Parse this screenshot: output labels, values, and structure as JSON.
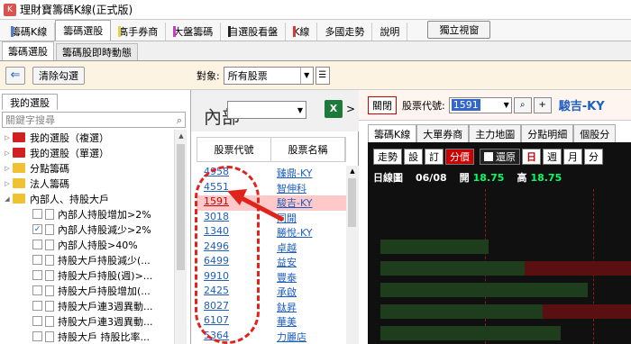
{
  "window": {
    "icon": "app-logo-icon",
    "title": "理財寶籌碼K線(正式版)"
  },
  "main_tabs": [
    {
      "label": "籌碼K線",
      "color": "#4a7fd4"
    },
    {
      "label": "籌碼選股",
      "color": "",
      "active": true
    },
    {
      "label": "高手券商",
      "color": "#e8d24a"
    },
    {
      "label": "大盤籌碼",
      "color": "#c83cc8"
    },
    {
      "label": "自選股看盤",
      "color": "#222222"
    },
    {
      "label": "K線",
      "color": "#d43c3c"
    },
    {
      "label": "多國走勢",
      "color": ""
    },
    {
      "label": "說明",
      "color": ""
    }
  ],
  "standalone_btn": "獨立視窗",
  "sub_tabs": [
    {
      "label": "籌碼選股",
      "active": true
    },
    {
      "label": "籌碼股即時動態",
      "active": false
    }
  ],
  "toolbar": {
    "clear_label": "清除勾選",
    "target_label": "對象:",
    "target_value": "所有股票"
  },
  "left": {
    "tab": "我的選股",
    "search_placeholder": "關鍵字搜尋",
    "items": [
      {
        "label": "我的選股（複選）",
        "folder": "#d21f1f",
        "type": "folder"
      },
      {
        "label": "我的選股（單選）",
        "folder": "#d21f1f",
        "type": "folder"
      },
      {
        "label": "分點籌碼",
        "folder": "#f0c232",
        "type": "folder"
      },
      {
        "label": "法人籌碼",
        "folder": "#f0c232",
        "type": "folder"
      },
      {
        "label": "內部人、持股大戶",
        "folder": "#f0c232",
        "type": "open"
      },
      {
        "label": "內部人持股增加>2%",
        "checked": false,
        "type": "leaf"
      },
      {
        "label": "內部人持股減少>2%",
        "checked": true,
        "type": "leaf"
      },
      {
        "label": "內部人持股>40%",
        "checked": false,
        "type": "leaf"
      },
      {
        "label": "持股大戶持股減少(...",
        "checked": false,
        "type": "leaf"
      },
      {
        "label": "持股大戶持股(週)>...",
        "checked": false,
        "type": "leaf"
      },
      {
        "label": "持股大戶持股增加(...",
        "checked": false,
        "type": "leaf"
      },
      {
        "label": "持股大戶連3週異動...",
        "checked": false,
        "type": "leaf"
      },
      {
        "label": "持股大戶連3週異動...",
        "checked": false,
        "type": "leaf"
      },
      {
        "label": "持股大戶 持股比率...",
        "checked": false,
        "type": "leaf"
      }
    ]
  },
  "mid": {
    "inner_label": "內部",
    "select_value": "",
    "excel_icon": "excel-icon",
    "col_code": "股票代號",
    "col_name": "股票名稱",
    "rows": [
      {
        "code": "4958",
        "name": "臻鼎-KY",
        "selected": false
      },
      {
        "code": "4551",
        "name": "智伸科",
        "selected": false
      },
      {
        "code": "1591",
        "name": "駿吉-KY",
        "selected": true
      },
      {
        "code": "3018",
        "name": "同開",
        "selected": false
      },
      {
        "code": "1340",
        "name": "勝悅-KY",
        "selected": false
      },
      {
        "code": "2496",
        "name": "卓越",
        "selected": false
      },
      {
        "code": "6499",
        "name": "益安",
        "selected": false
      },
      {
        "code": "9910",
        "name": "豐泰",
        "selected": false
      },
      {
        "code": "2425",
        "name": "承啟",
        "selected": false
      },
      {
        "code": "8027",
        "name": "鈦昇",
        "selected": false
      },
      {
        "code": "6107",
        "name": "華美",
        "selected": false
      },
      {
        "code": "5364",
        "name": "力麗店",
        "selected": false
      }
    ]
  },
  "right": {
    "close_btn": "關閉",
    "code_label": "股票代號:",
    "code_value": "1591",
    "stock_name": "駿吉-KY",
    "tabs": [
      {
        "label": "籌碼K線",
        "active": true
      },
      {
        "label": "大單券商",
        "active": false
      },
      {
        "label": "主力地圖",
        "active": false
      },
      {
        "label": "分點明細",
        "active": false
      },
      {
        "label": "個股分",
        "active": false
      }
    ],
    "chart_toolbar": {
      "btns": [
        "走勢",
        "設",
        "訂"
      ],
      "active_btn": "分價",
      "restore": "還原",
      "periods": [
        "日",
        "週",
        "月"
      ],
      "active_period": "日",
      "split": "分"
    },
    "info": {
      "label": "日線圖",
      "date": "06/08",
      "open_label": "開",
      "open": "18.75",
      "high_label": "高",
      "high": "18.75"
    }
  }
}
